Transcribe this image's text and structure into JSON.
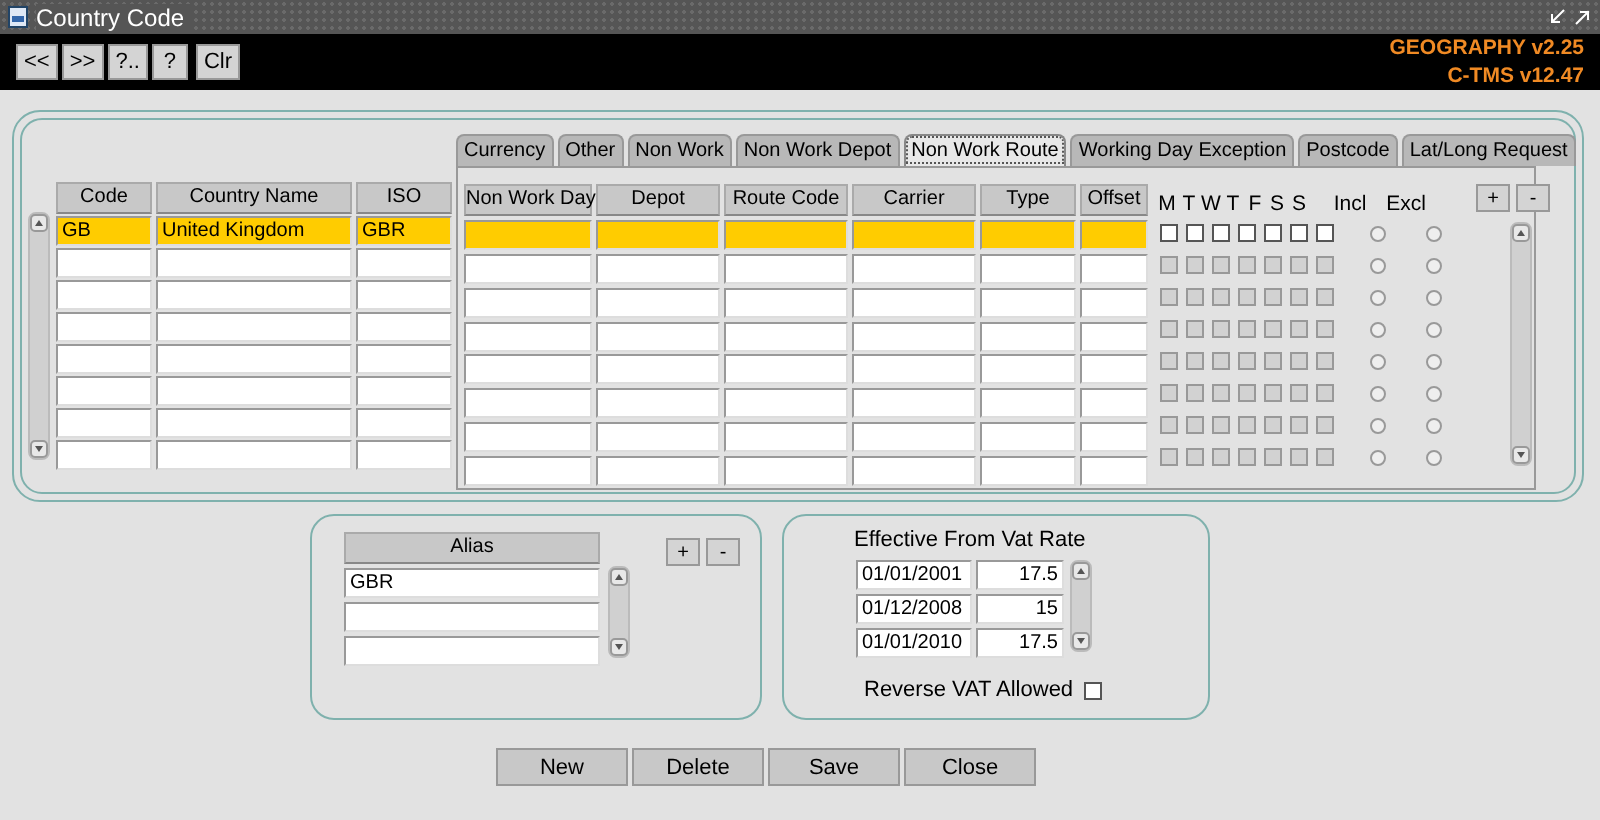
{
  "window": {
    "title": "Country Code"
  },
  "toolbar": {
    "buttons": [
      "<<",
      ">>",
      "?..",
      "?",
      "Clr"
    ],
    "versions": [
      "GEOGRAPHY v2.25",
      "C-TMS v12.47"
    ]
  },
  "country_table": {
    "columns": [
      "Code",
      "Country Name",
      "ISO"
    ],
    "rows": [
      {
        "selected": true,
        "cells": [
          "GB",
          "United Kingdom",
          "GBR"
        ]
      },
      {
        "selected": false
      },
      {
        "selected": false
      },
      {
        "selected": false
      },
      {
        "selected": false
      },
      {
        "selected": false
      },
      {
        "selected": false
      },
      {
        "selected": false
      }
    ]
  },
  "tabs": [
    {
      "label": "Currency",
      "selected": false
    },
    {
      "label": "Other",
      "selected": false
    },
    {
      "label": "Non Work",
      "selected": false
    },
    {
      "label": "Non Work Depot",
      "selected": false
    },
    {
      "label": "Non Work Route",
      "selected": true
    },
    {
      "label": "Working Day Exception",
      "selected": false
    },
    {
      "label": "Postcode",
      "selected": false
    },
    {
      "label": "Lat/Long Request",
      "selected": false
    }
  ],
  "route_table": {
    "columns": [
      "Non Work Day",
      "Depot",
      "Route Code",
      "Carrier",
      "Type",
      "Offset"
    ],
    "day_letters": [
      "M",
      "T",
      "W",
      "T",
      "F",
      "S",
      "S"
    ],
    "incl_label": "Incl",
    "excl_label": "Excl",
    "add_button": "+",
    "remove_button": "-",
    "rows": [
      {
        "selected": true,
        "days": [
          false,
          false,
          false,
          false,
          false,
          false,
          false
        ],
        "incl": false,
        "excl": false
      },
      {
        "selected": false,
        "days": [
          false,
          false,
          false,
          false,
          false,
          false,
          false
        ],
        "incl": false,
        "excl": false
      },
      {
        "selected": false,
        "days": [
          false,
          false,
          false,
          false,
          false,
          false,
          false
        ],
        "incl": false,
        "excl": false
      },
      {
        "selected": false,
        "days": [
          false,
          false,
          false,
          false,
          false,
          false,
          false
        ],
        "incl": false,
        "excl": false
      },
      {
        "selected": false,
        "days": [
          false,
          false,
          false,
          false,
          false,
          false,
          false
        ],
        "incl": false,
        "excl": false
      },
      {
        "selected": false,
        "days": [
          false,
          false,
          false,
          false,
          false,
          false,
          false
        ],
        "incl": false,
        "excl": false
      },
      {
        "selected": false,
        "days": [
          false,
          false,
          false,
          false,
          false,
          false,
          false
        ],
        "incl": false,
        "excl": false
      },
      {
        "selected": false,
        "days": [
          false,
          false,
          false,
          false,
          false,
          false,
          false
        ],
        "incl": false,
        "excl": false
      }
    ]
  },
  "alias": {
    "header": "Alias",
    "add_button": "+",
    "remove_button": "-",
    "rows": [
      "GBR",
      null,
      null
    ]
  },
  "vat": {
    "header": "Effective From  Vat Rate",
    "rows": [
      {
        "date": "01/01/2001",
        "rate": "17.5"
      },
      {
        "date": "01/12/2008",
        "rate": "15"
      },
      {
        "date": "01/01/2010",
        "rate": "17.5"
      }
    ],
    "reverse_label": "Reverse VAT Allowed",
    "reverse_checked": false
  },
  "buttons": [
    "New",
    "Delete",
    "Save",
    "Close"
  ]
}
